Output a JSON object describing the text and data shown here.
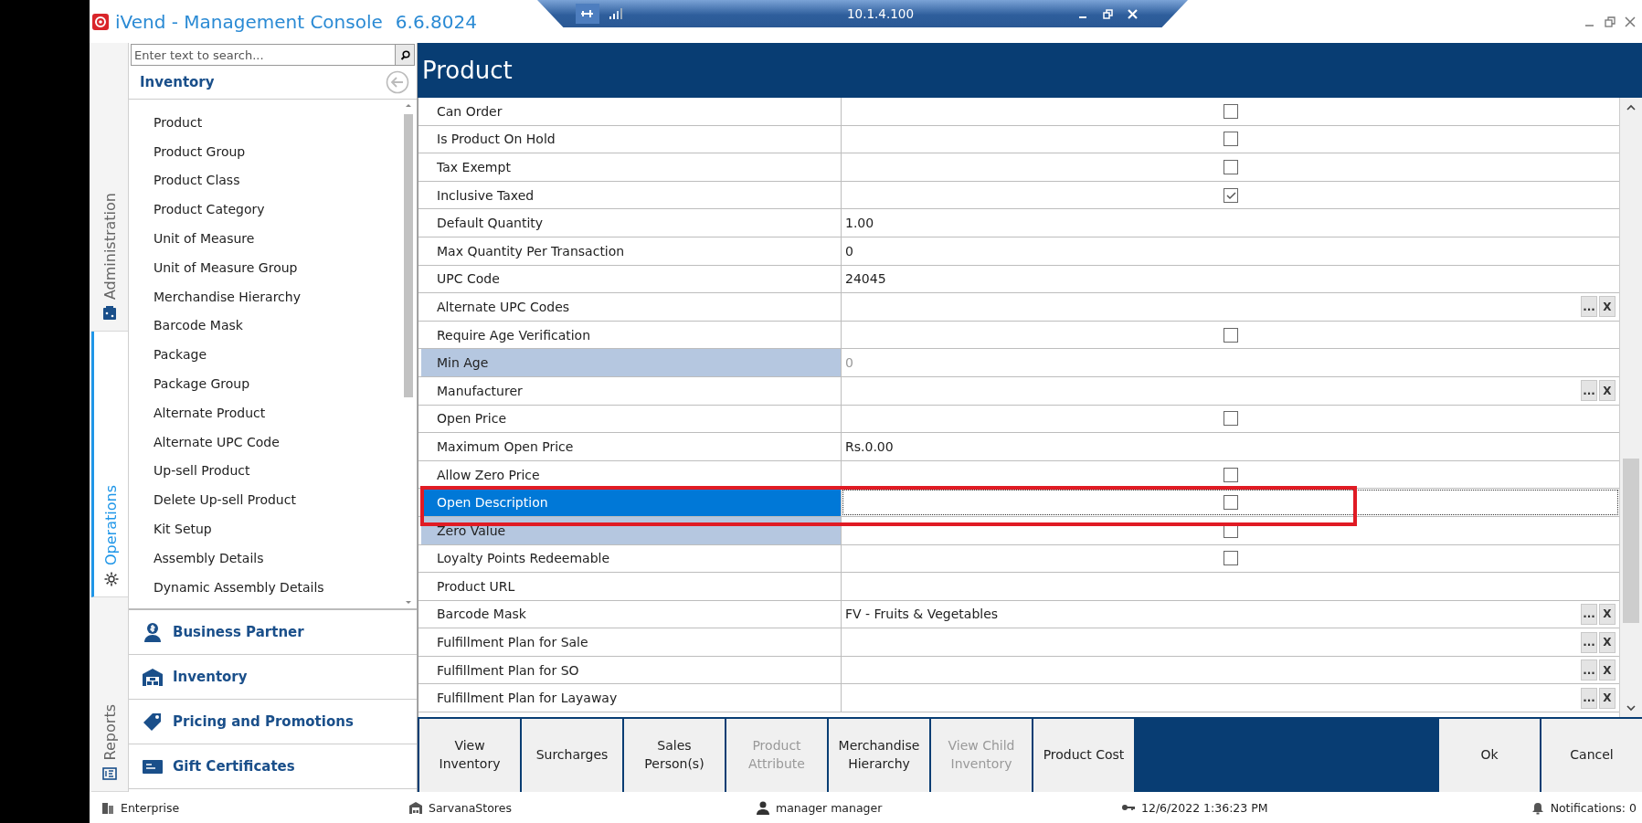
{
  "window": {
    "title": "iVend - Management Console",
    "version": "6.6.8024"
  },
  "remote_bar": {
    "address": "10.1.4.100"
  },
  "side_tabs": [
    {
      "label": "Administration",
      "kind": "admin",
      "selected": false
    },
    {
      "label": "Operations",
      "kind": "gear",
      "selected": true
    },
    {
      "label": "Reports",
      "kind": "report",
      "selected": false
    }
  ],
  "nav": {
    "search": {
      "placeholder": "Enter text to search..."
    },
    "section_title": "Inventory",
    "items": [
      "Product",
      "Product Group",
      "Product Class",
      "Product Category",
      "Unit of Measure",
      "Unit of Measure Group",
      "Merchandise Hierarchy",
      "Barcode Mask",
      "Package",
      "Package Group",
      "Alternate Product",
      "Alternate UPC Code",
      "Up-sell Product",
      "Delete Up-sell Product",
      "Kit Setup",
      "Assembly Details",
      "Dynamic Assembly Details"
    ],
    "groups": [
      {
        "label": "Business Partner",
        "kind": "partner"
      },
      {
        "label": "Inventory",
        "kind": "warehouse"
      },
      {
        "label": "Pricing and Promotions",
        "kind": "tag"
      },
      {
        "label": "Gift Certificates",
        "kind": "card"
      }
    ]
  },
  "page": {
    "title": "Product",
    "rows": [
      {
        "label": "Can Order",
        "kind": "checkbox",
        "checked": false,
        "selected": false,
        "disabled": false,
        "highlighted": false
      },
      {
        "label": "Is Product On Hold",
        "kind": "checkbox",
        "checked": false,
        "selected": false,
        "disabled": false,
        "highlighted": false
      },
      {
        "label": "Tax Exempt",
        "kind": "checkbox",
        "checked": false,
        "selected": false,
        "disabled": false,
        "highlighted": false
      },
      {
        "label": "Inclusive Taxed",
        "kind": "checkbox",
        "checked": true,
        "selected": false,
        "disabled": false,
        "highlighted": false
      },
      {
        "label": "Default Quantity",
        "kind": "text",
        "value": "1.00",
        "selected": false,
        "disabled": false,
        "highlighted": false
      },
      {
        "label": "Max Quantity Per Transaction",
        "kind": "text",
        "value": "0",
        "selected": false,
        "disabled": false,
        "highlighted": false
      },
      {
        "label": "UPC Code",
        "kind": "text",
        "value": "24045",
        "selected": false,
        "disabled": false,
        "highlighted": false
      },
      {
        "label": "Alternate UPC Codes",
        "kind": "lookup",
        "buttons": [
          "...",
          "X"
        ],
        "selected": false,
        "disabled": false,
        "highlighted": false
      },
      {
        "label": "Require Age Verification",
        "kind": "checkbox",
        "checked": false,
        "selected": false,
        "disabled": false,
        "highlighted": false
      },
      {
        "label": "Min Age",
        "kind": "text",
        "value": "0",
        "selected": false,
        "disabled": true,
        "highlighted": false
      },
      {
        "label": "Manufacturer",
        "kind": "lookup",
        "buttons": [
          "...",
          "X"
        ],
        "selected": false,
        "disabled": false,
        "highlighted": false
      },
      {
        "label": "Open Price",
        "kind": "checkbox",
        "checked": false,
        "selected": false,
        "disabled": false,
        "highlighted": false
      },
      {
        "label": "Maximum Open Price",
        "kind": "text",
        "value": "Rs.0.00",
        "selected": false,
        "disabled": false,
        "highlighted": false
      },
      {
        "label": "Allow Zero Price",
        "kind": "checkbox",
        "checked": false,
        "selected": false,
        "disabled": false,
        "highlighted": false
      },
      {
        "label": "Open Description",
        "kind": "checkbox",
        "checked": false,
        "selected": true,
        "disabled": false,
        "highlighted": true
      },
      {
        "label": "Zero Value",
        "kind": "checkbox",
        "checked": false,
        "selected": false,
        "disabled": true,
        "highlighted": false
      },
      {
        "label": "Loyalty Points Redeemable",
        "kind": "checkbox",
        "checked": false,
        "selected": false,
        "disabled": false,
        "highlighted": false
      },
      {
        "label": "Product URL",
        "kind": "text",
        "selected": false,
        "disabled": false,
        "highlighted": false
      },
      {
        "label": "Barcode Mask",
        "kind": "lookup",
        "value": "FV - Fruits & Vegetables",
        "buttons": [
          "...",
          "X"
        ],
        "selected": false,
        "disabled": false,
        "highlighted": false
      },
      {
        "label": "Fulfillment Plan for Sale",
        "kind": "lookup",
        "buttons": [
          "...",
          "X"
        ],
        "selected": false,
        "disabled": false,
        "highlighted": false
      },
      {
        "label": "Fulfillment Plan for SO",
        "kind": "lookup",
        "buttons": [
          "...",
          "X"
        ],
        "selected": false,
        "disabled": false,
        "highlighted": false
      },
      {
        "label": "Fulfillment Plan for Layaway",
        "kind": "lookup",
        "buttons": [
          "...",
          "X"
        ],
        "selected": false,
        "disabled": false,
        "highlighted": false
      }
    ]
  },
  "actions": [
    {
      "label": "View Inventory",
      "disabled": false
    },
    {
      "label": "Surcharges",
      "disabled": false
    },
    {
      "label": "Sales Person(s)",
      "disabled": false
    },
    {
      "label": "Product Attribute",
      "disabled": true
    },
    {
      "label": "Merchandise Hierarchy",
      "disabled": false
    },
    {
      "label": "View Child Inventory",
      "disabled": true
    },
    {
      "label": "Product Cost",
      "disabled": false
    }
  ],
  "dialog_buttons": [
    "Ok",
    "Cancel"
  ],
  "status_bar": [
    {
      "text": "Enterprise",
      "kind": "enterprise"
    },
    {
      "text": "SarvanaStores",
      "kind": "store"
    },
    {
      "text": "manager manager",
      "kind": "user"
    },
    {
      "text": "12/6/2022 1:36:23 PM",
      "kind": "key"
    },
    {
      "text": "Notifications: 0",
      "kind": "bell"
    }
  ]
}
